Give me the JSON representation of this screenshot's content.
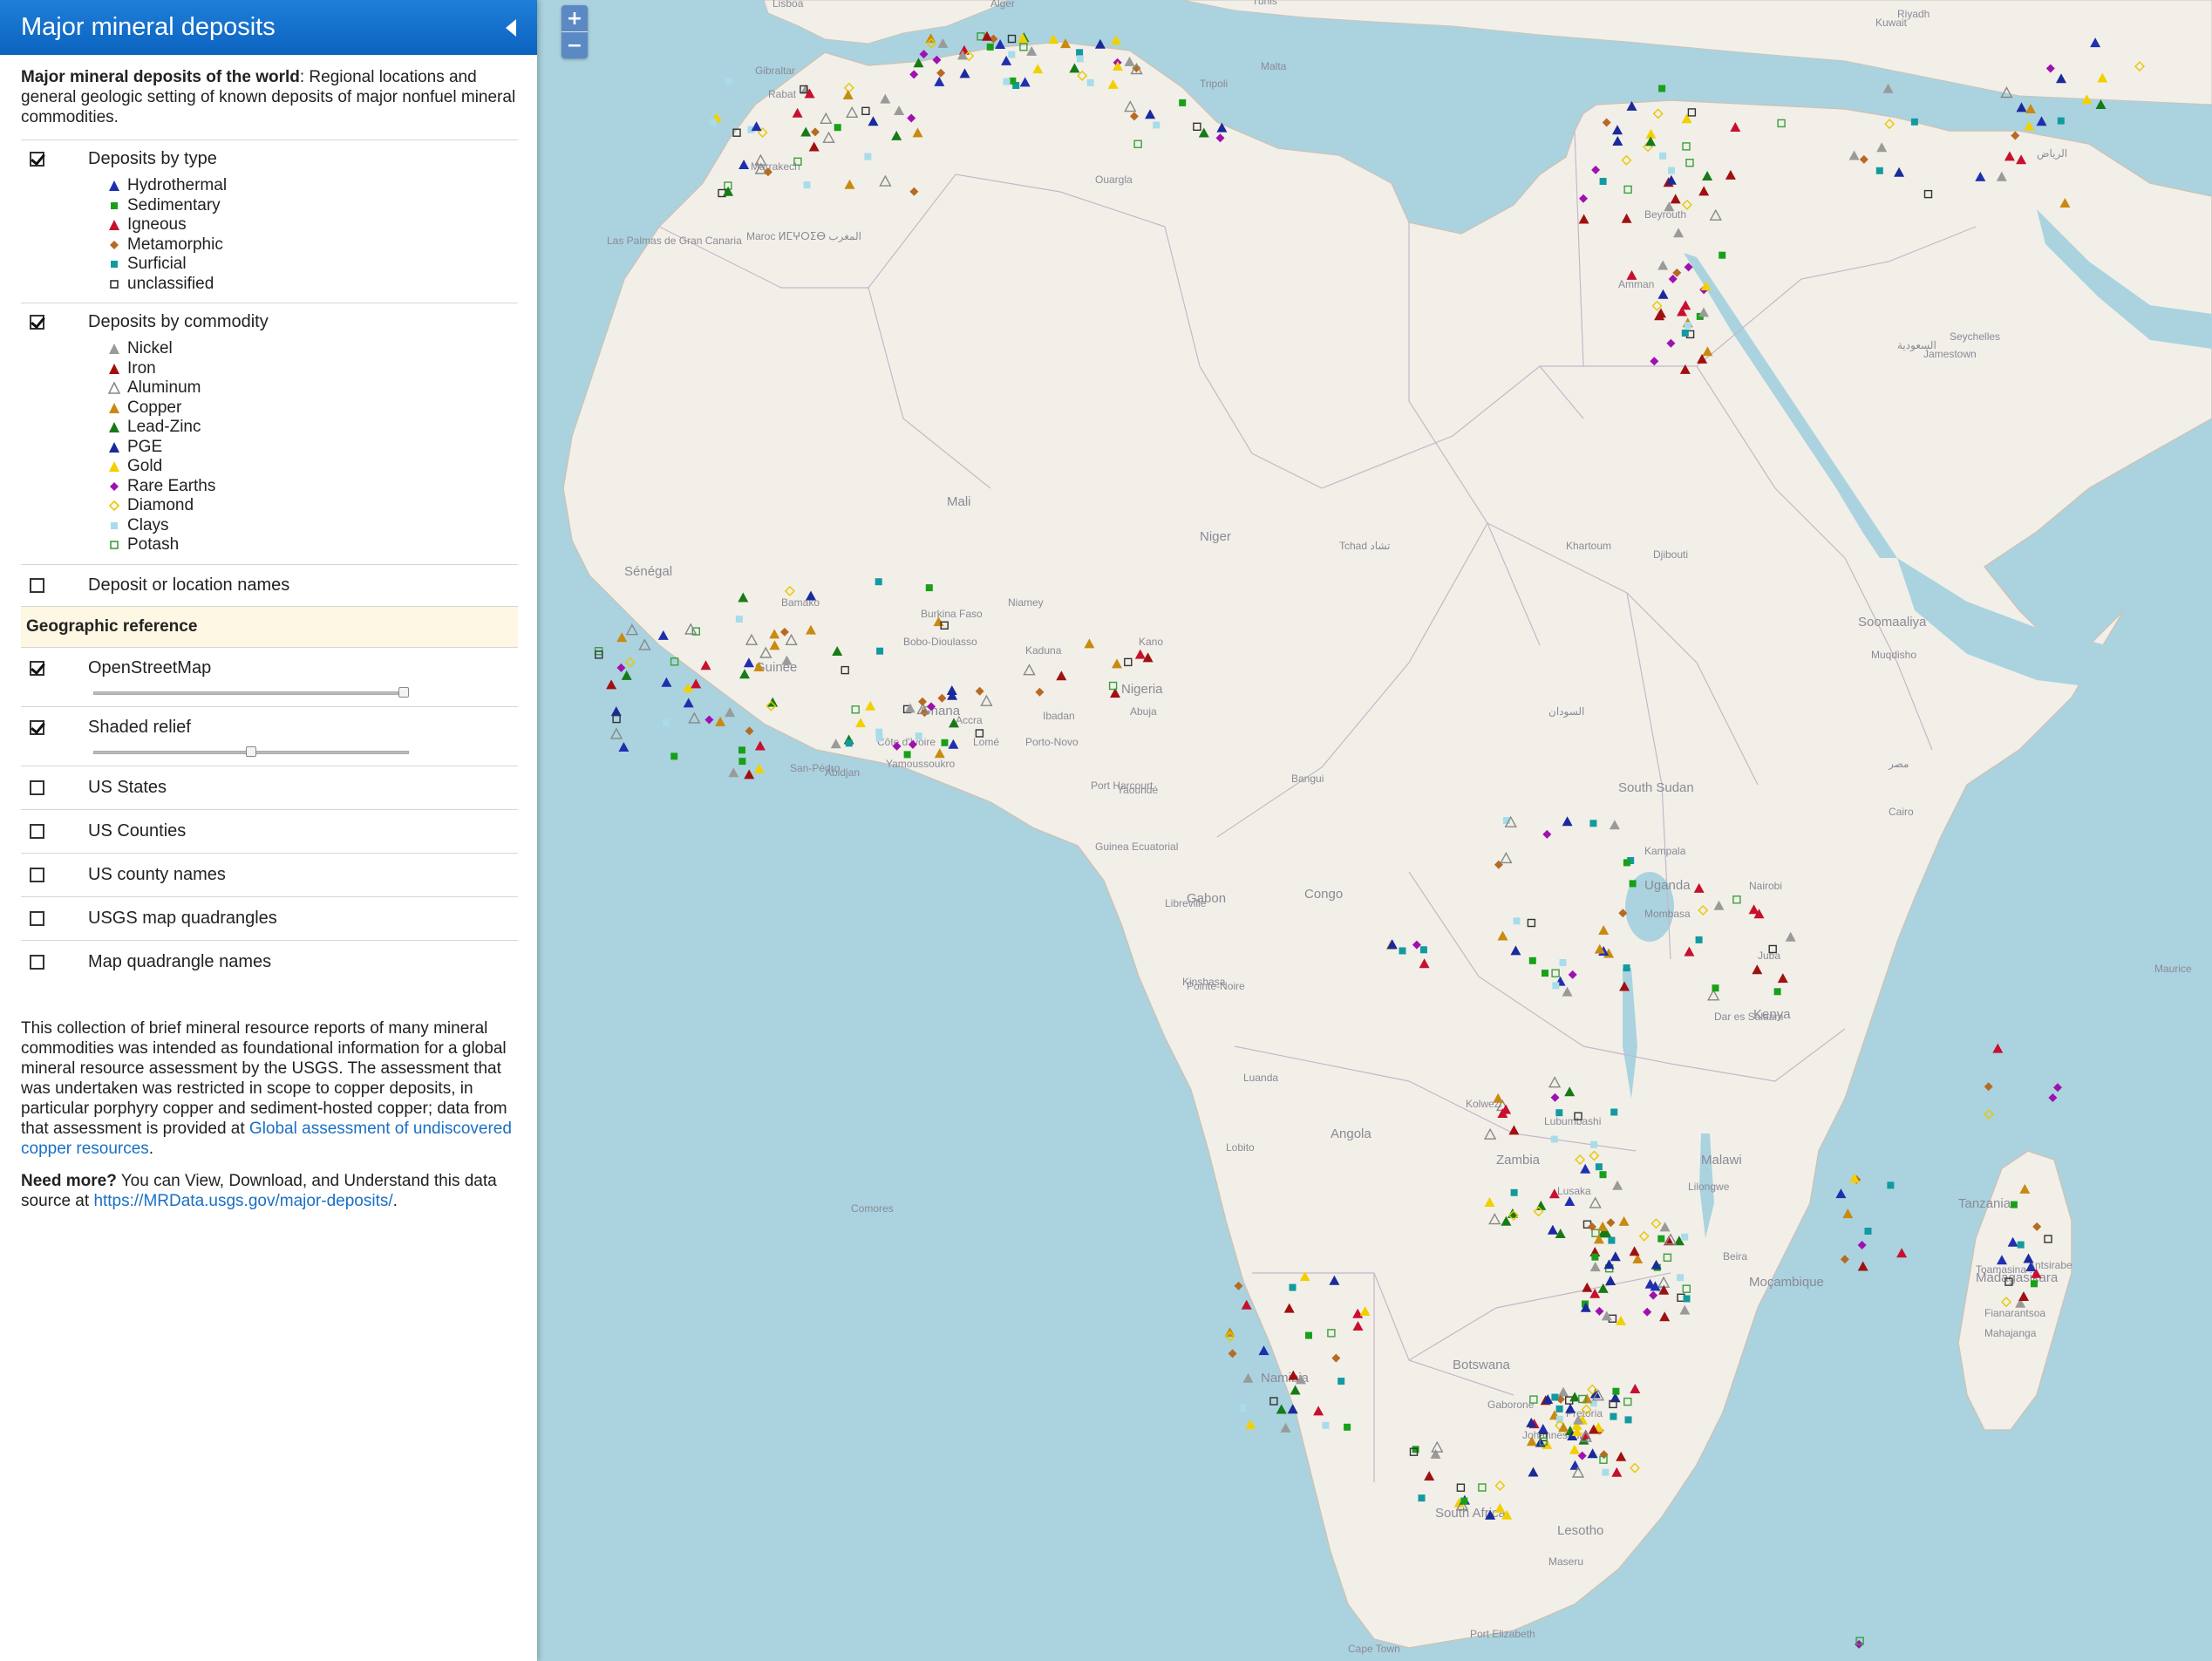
{
  "panel": {
    "title": "Major mineral deposits",
    "intro_bold": "Major mineral deposits of the world",
    "intro_rest": ": Regional locations and general geologic setting of known deposits of major nonfuel mineral commodities."
  },
  "deposits_by_type": {
    "label": "Deposits by type",
    "checked": true,
    "items": [
      {
        "label": "Hydrothermal",
        "icon": "triangle",
        "color": "#1f2fb0"
      },
      {
        "label": "Sedimentary",
        "icon": "square",
        "color": "#18a018"
      },
      {
        "label": "Igneous",
        "icon": "triangle",
        "color": "#c8102e"
      },
      {
        "label": "Metamorphic",
        "icon": "diamond",
        "color": "#b86a22"
      },
      {
        "label": "Surficial",
        "icon": "square",
        "color": "#129aa0"
      },
      {
        "label": "unclassified",
        "icon": "square-outline",
        "color": "#333333"
      }
    ]
  },
  "deposits_by_commodity": {
    "label": "Deposits by commodity",
    "checked": true,
    "items": [
      {
        "label": "Nickel",
        "icon": "triangle",
        "color": "#9a9a9a"
      },
      {
        "label": "Iron",
        "icon": "triangle",
        "color": "#a01010"
      },
      {
        "label": "Aluminum",
        "icon": "triangle-outline",
        "color": "#888888"
      },
      {
        "label": "Copper",
        "icon": "triangle",
        "color": "#c88a10"
      },
      {
        "label": "Lead-Zinc",
        "icon": "triangle",
        "color": "#177a17"
      },
      {
        "label": "PGE",
        "icon": "triangle",
        "color": "#1a2a9a"
      },
      {
        "label": "Gold",
        "icon": "triangle",
        "color": "#f2d000"
      },
      {
        "label": "Rare Earths",
        "icon": "diamond",
        "color": "#a010b0"
      },
      {
        "label": "Diamond",
        "icon": "diamond-outline",
        "color": "#e6c800"
      },
      {
        "label": "Clays",
        "icon": "square",
        "color": "#a8dcea"
      },
      {
        "label": "Potash",
        "icon": "square-outline",
        "color": "#3aa03a"
      }
    ]
  },
  "names_toggle": {
    "label": "Deposit or location names",
    "checked": false
  },
  "geo_reference": {
    "heading": "Geographic reference",
    "layers": [
      {
        "label": "OpenStreetMap",
        "checked": true,
        "opacity": 1.0
      },
      {
        "label": "Shaded relief",
        "checked": true,
        "opacity": 0.5
      },
      {
        "label": "US States",
        "checked": false
      },
      {
        "label": "US Counties",
        "checked": false
      },
      {
        "label": "US county names",
        "checked": false
      },
      {
        "label": "USGS map quadrangles",
        "checked": false
      },
      {
        "label": "Map quadrangle names",
        "checked": false
      }
    ]
  },
  "description": {
    "text": "This collection of brief mineral resource reports of many mineral commodities was intended as foundational information for a global mineral resource assessment by the USGS. The assessment that was undertaken was restricted in scope to copper deposits, in particular porphyry copper and sediment-hosted copper; data from that assessment is provided at ",
    "link": "Global assessment of undiscovered copper resources",
    "end": "."
  },
  "need_more": {
    "bold": "Need more?",
    "text": " You can View, Download, and Understand this data source at ",
    "link": "https://MRData.usgs.gov/major-deposits/",
    "end": "."
  },
  "zoom": {
    "in": "+",
    "out": "−"
  },
  "map_labels": [
    "Lisboa",
    "Gibraltar",
    "Rabat",
    "Marrakech",
    "Las Palmas de Gran Canaria",
    "Maroc ⵍⵎⵖⵔⵉⴱ المغرب",
    "Alger",
    "Tunis",
    "Malta",
    "Ouargla",
    "Tripoli",
    "Mali",
    "Niger",
    "Tchad تشاد",
    "Sénégal",
    "Bamako",
    "Niamey",
    "Burkina Faso",
    "Bobo-Dioulasso",
    "Kano",
    "Kaduna",
    "Nigeria",
    "Abuja",
    "Ghana",
    "Accra",
    "Côte d'Ivoire",
    "Yamoussoukro",
    "Abidjan",
    "San-Pédro",
    "Guinée",
    "Lomé",
    "Porto-Novo",
    "Ibadan",
    "Port Harcourt",
    "Yaoundé",
    "Bangui",
    "Kinshasa",
    "Pointe-Noire",
    "Libreville",
    "Gabon",
    "Congo",
    "Guinea Ecuatorial",
    "Luanda",
    "Angola",
    "Lobito",
    "Namibia",
    "Botswana",
    "Zambia",
    "Lusaka",
    "Lubumbashi",
    "Kolwezi",
    "Malawi",
    "Lilongwe",
    "Moçambique",
    "Beira",
    "Gaborone",
    "Pretoria",
    "Johannesburg",
    "Lesotho",
    "Maseru",
    "South Africa",
    "Cape Town",
    "Port Elizabeth",
    "Madagasikara",
    "Toamasina",
    "Antsirabe",
    "Fianarantsoa",
    "Mahajanga",
    "Tanzania",
    "Dar es Salaam",
    "Kenya",
    "Nairobi",
    "Uganda",
    "Kampala",
    "Mombasa",
    "Juba",
    "South Sudan",
    "السودان",
    "Khartoum",
    "Djibouti",
    "Soomaaliya",
    "Muqdisho",
    "مصر",
    "Cairo",
    "Amman",
    "Beyrouth",
    "Kuwait",
    "Riyadh",
    "الرياض",
    "السعودية",
    "Jamestown",
    "Seychelles",
    "Comores",
    "Maurice"
  ]
}
